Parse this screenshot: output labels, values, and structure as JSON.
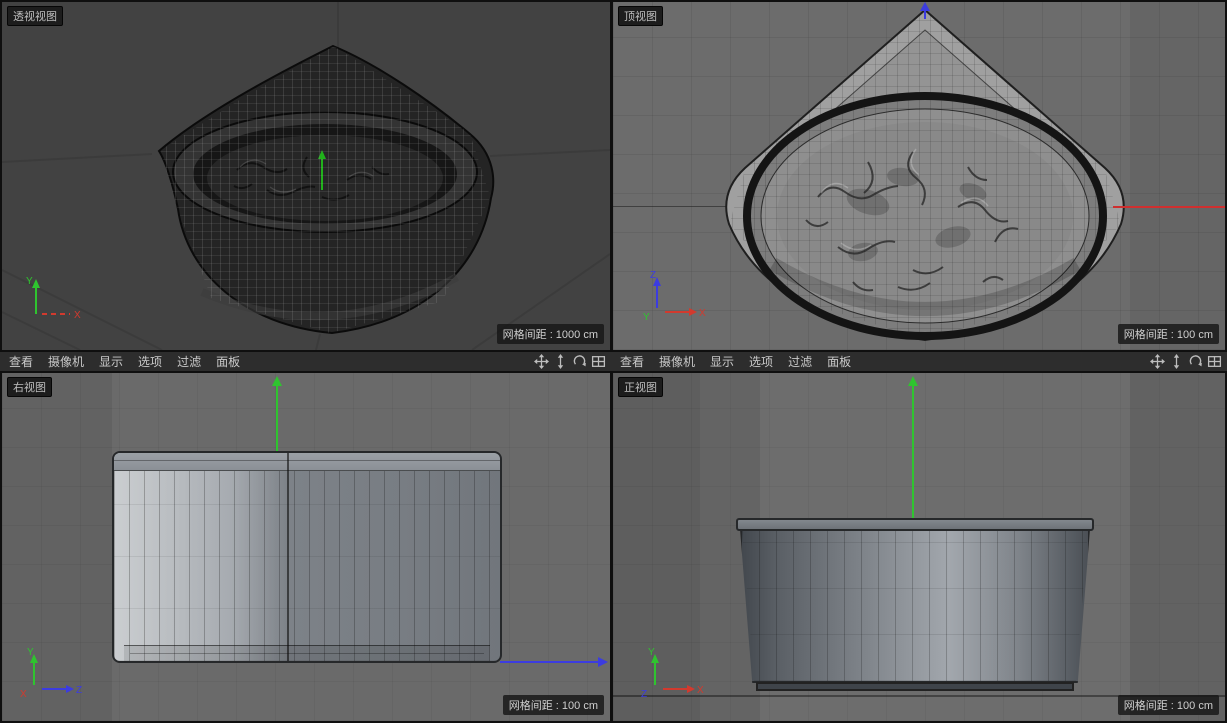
{
  "viewports": {
    "perspective": {
      "label": "透视视图",
      "grid_spacing": "网格间距 : 1000 cm"
    },
    "top": {
      "label": "顶视图",
      "grid_spacing": "网格间距 : 100 cm"
    },
    "right": {
      "label": "右视图",
      "grid_spacing": "网格间距 : 100 cm"
    },
    "front": {
      "label": "正视图",
      "grid_spacing": "网格间距 : 100 cm"
    }
  },
  "menubar": {
    "items": [
      {
        "label": "查看"
      },
      {
        "label": "摄像机"
      },
      {
        "label": "显示"
      },
      {
        "label": "选项"
      },
      {
        "label": "过滤"
      },
      {
        "label": "面板"
      }
    ],
    "icons": [
      {
        "name": "pan-icon"
      },
      {
        "name": "dolly-icon"
      },
      {
        "name": "rotate-icon"
      },
      {
        "name": "toggle-view-icon"
      }
    ]
  },
  "axes": {
    "x": "X",
    "y": "Y",
    "z": "Z"
  },
  "colors": {
    "axis_x": "#d23a2e",
    "axis_y": "#2fc42f",
    "axis_z": "#3c3ce0",
    "perspective_bg": "#424242",
    "ortho_bg": "#6b6b6b",
    "menubar_bg": "#2d2d2d",
    "badge_bg": "#1d1d1d"
  }
}
